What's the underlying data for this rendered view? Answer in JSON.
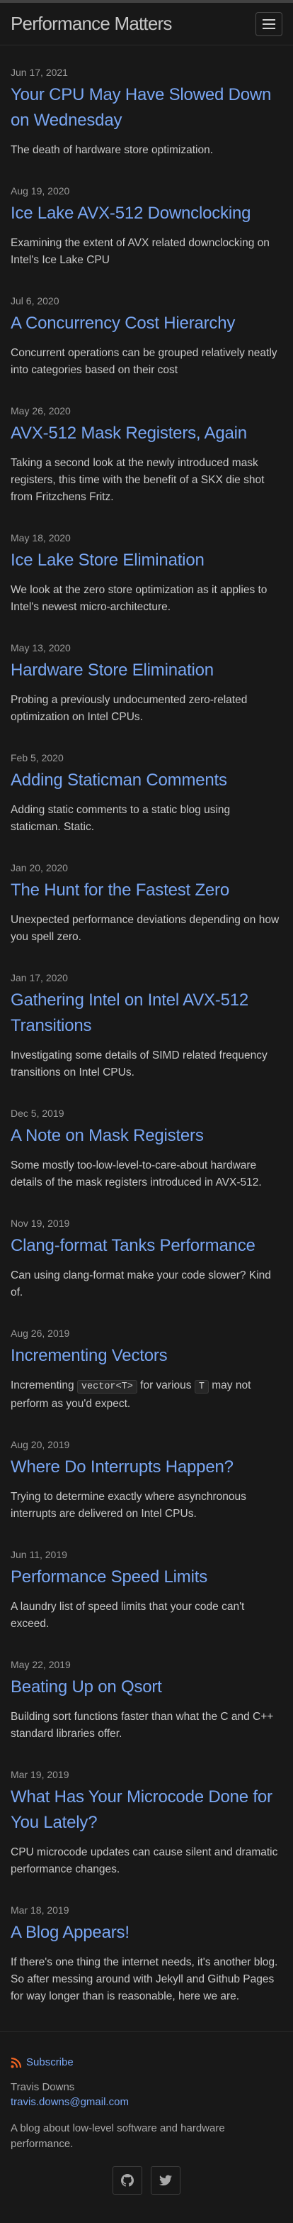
{
  "site": {
    "title": "Performance Matters"
  },
  "posts": [
    {
      "date": "Jun 17, 2021",
      "title": "Your CPU May Have Slowed Down on Wednesday",
      "excerpt": "The death of hardware store optimization."
    },
    {
      "date": "Aug 19, 2020",
      "title": "Ice Lake AVX-512 Downclocking",
      "excerpt": "Examining the extent of AVX related downclocking on Intel's Ice Lake CPU"
    },
    {
      "date": "Jul 6, 2020",
      "title": "A Concurrency Cost Hierarchy",
      "excerpt": "Concurrent operations can be grouped relatively neatly into categories based on their cost"
    },
    {
      "date": "May 26, 2020",
      "title": "AVX-512 Mask Registers, Again",
      "excerpt": "Taking a second look at the newly introduced mask registers, this time with the benefit of a SKX die shot from Fritzchens Fritz."
    },
    {
      "date": "May 18, 2020",
      "title": "Ice Lake Store Elimination",
      "excerpt": "We look at the zero store optimization as it applies to Intel's newest micro-architecture."
    },
    {
      "date": "May 13, 2020",
      "title": "Hardware Store Elimination",
      "excerpt": "Probing a previously undocumented zero-related optimization on Intel CPUs."
    },
    {
      "date": "Feb 5, 2020",
      "title": "Adding Staticman Comments",
      "excerpt": "Adding static comments to a static blog using staticman. Static."
    },
    {
      "date": "Jan 20, 2020",
      "title": "The Hunt for the Fastest Zero",
      "excerpt": "Unexpected performance deviations depending on how you spell zero."
    },
    {
      "date": "Jan 17, 2020",
      "title": "Gathering Intel on Intel AVX-512 Transitions",
      "excerpt": "Investigating some details of SIMD related frequency transitions on Intel CPUs."
    },
    {
      "date": "Dec 5, 2019",
      "title": "A Note on Mask Registers",
      "excerpt": "Some mostly too-low-level-to-care-about hardware details of the mask registers introduced in AVX-512."
    },
    {
      "date": "Nov 19, 2019",
      "title": "Clang-format Tanks Performance",
      "excerpt": "Can using clang-format make your code slower? Kind of."
    },
    {
      "date": "Aug 26, 2019",
      "title": "Incrementing Vectors",
      "excerpt_parts": [
        "Incrementing",
        "vector<T>",
        "for various",
        "T",
        "may not perform as you'd expect."
      ]
    },
    {
      "date": "Aug 20, 2019",
      "title": "Where Do Interrupts Happen?",
      "excerpt": "Trying to determine exactly where asynchronous interrupts are delivered on Intel CPUs."
    },
    {
      "date": "Jun 11, 2019",
      "title": "Performance Speed Limits",
      "excerpt": "A laundry list of speed limits that your code can't exceed."
    },
    {
      "date": "May 22, 2019",
      "title": "Beating Up on Qsort",
      "excerpt": "Building sort functions faster than what the C and C++ standard libraries offer."
    },
    {
      "date": "Mar 19, 2019",
      "title": "What Has Your Microcode Done for You Lately?",
      "excerpt": "CPU microcode updates can cause silent and dramatic performance changes."
    },
    {
      "date": "Mar 18, 2019",
      "title": "A Blog Appears!",
      "excerpt": "If there's one thing the internet needs, it's another blog. So after messing around with Jekyll and Github Pages for way longer than is reasonable, here we are."
    }
  ],
  "footer": {
    "subscribe_label": "Subscribe",
    "name": "Travis Downs",
    "email": "travis.downs@gmail.com",
    "description": "A blog about low-level software and hardware performance.",
    "social": [
      {
        "icon": "github-icon"
      },
      {
        "icon": "twitter-icon"
      }
    ]
  },
  "colors": {
    "background": "#181818",
    "link": "#79a6f2",
    "rss": "#f26522"
  }
}
